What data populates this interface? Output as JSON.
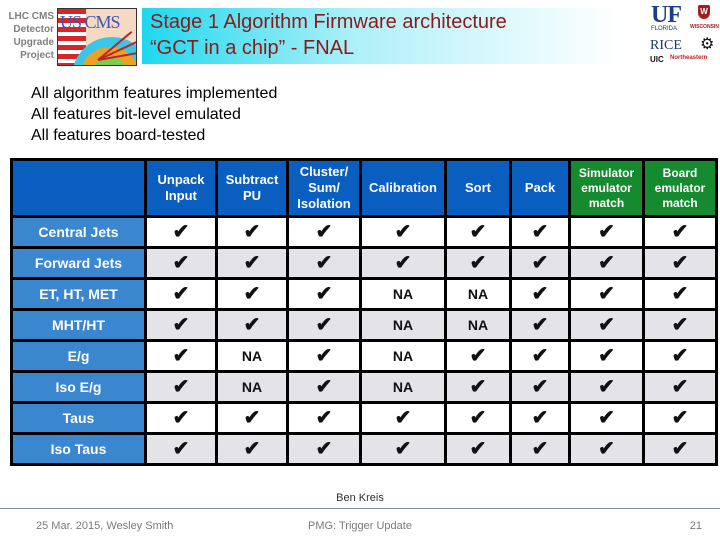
{
  "header": {
    "org_lines": [
      "LHC CMS",
      "Detector",
      "Upgrade",
      "Project"
    ],
    "cms_logo_text": "US CMS",
    "title_line1": "Stage 1 Algorithm Firmware architecture",
    "title_line2": "“GCT in a chip” - FNAL",
    "partner_logos": {
      "uf": "UF",
      "uf_sub": "FLORIDA",
      "wisconsin_mark": "W",
      "wisconsin_sub": "WISCONSIN",
      "rice": "RICE",
      "gear_icon": "⚙",
      "uic": "UIC",
      "northeastern": "Northeastern"
    }
  },
  "bullets": [
    "All algorithm features implemented",
    "All features bit-level emulated",
    "All features board-tested"
  ],
  "table": {
    "columns": [
      {
        "label": "Unpack Input",
        "group": "algorithm"
      },
      {
        "label": "Subtract PU",
        "group": "algorithm"
      },
      {
        "label": "Cluster/ Sum/ Isolation",
        "group": "algorithm"
      },
      {
        "label": "Calibration",
        "group": "algorithm"
      },
      {
        "label": "Sort",
        "group": "algorithm"
      },
      {
        "label": "Pack",
        "group": "algorithm"
      },
      {
        "label": "Simulator emulator match",
        "group": "validation"
      },
      {
        "label": "Board emulator match",
        "group": "validation"
      }
    ],
    "check_symbol": "✔",
    "rows": [
      {
        "label": "Central Jets",
        "values": [
          "✔",
          "✔",
          "✔",
          "✔",
          "✔",
          "✔",
          "✔",
          "✔"
        ]
      },
      {
        "label": "Forward Jets",
        "values": [
          "✔",
          "✔",
          "✔",
          "✔",
          "✔",
          "✔",
          "✔",
          "✔"
        ]
      },
      {
        "label": "ET, HT, MET",
        "values": [
          "✔",
          "✔",
          "✔",
          "NA",
          "NA",
          "✔",
          "✔",
          "✔"
        ]
      },
      {
        "label": "MHT/HT",
        "values": [
          "✔",
          "✔",
          "✔",
          "NA",
          "NA",
          "✔",
          "✔",
          "✔"
        ]
      },
      {
        "label": "E/g",
        "values": [
          "✔",
          "NA",
          "✔",
          "NA",
          "✔",
          "✔",
          "✔",
          "✔"
        ]
      },
      {
        "label": "Iso E/g",
        "values": [
          "✔",
          "NA",
          "✔",
          "NA",
          "✔",
          "✔",
          "✔",
          "✔"
        ]
      },
      {
        "label": "Taus",
        "values": [
          "✔",
          "✔",
          "✔",
          "✔",
          "✔",
          "✔",
          "✔",
          "✔"
        ]
      },
      {
        "label": "Iso Taus",
        "values": [
          "✔",
          "✔",
          "✔",
          "✔",
          "✔",
          "✔",
          "✔",
          "✔"
        ]
      }
    ],
    "colors": {
      "header_blue": "#0a5ec0",
      "header_green": "#168a2f",
      "row_label_blue": "#3a87cf",
      "row_alt": "#e4e4e8"
    }
  },
  "credit": "Ben Kreis",
  "footer": {
    "left": "25 Mar. 2015, Wesley Smith",
    "center": "PMG: Trigger Update",
    "page_number": "21"
  }
}
